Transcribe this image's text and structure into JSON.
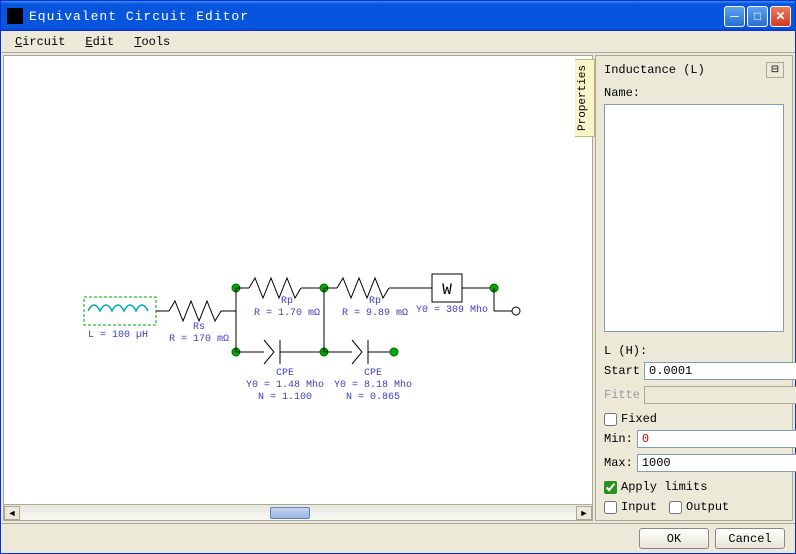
{
  "window": {
    "title": "Equivalent Circuit Editor"
  },
  "menu": {
    "circuit": "Circuit",
    "edit": "Edit",
    "tools": "Tools"
  },
  "panel": {
    "tab": "Properties",
    "title": "Inductance (L)",
    "name_label": "Name:",
    "name_value": "",
    "lh_label": "L (H):",
    "start_label": "Start",
    "start_value": "0.0001",
    "fitte_label": "Fitte",
    "fitte_value": "",
    "fixed_label": "Fixed",
    "min_label": "Min:",
    "min_value": "0",
    "max_label": "Max:",
    "max_value": "1000",
    "apply_label": "Apply limits",
    "input_label": "Input",
    "output_label": "Output"
  },
  "buttons": {
    "ok": "OK",
    "cancel": "Cancel"
  },
  "schematic": {
    "L": {
      "name": "L",
      "value": "L = 100 µH"
    },
    "Rs": {
      "name": "Rs",
      "value": "R = 170 mΩ"
    },
    "Rp1": {
      "name": "Rp",
      "value": "R = 1.70 mΩ"
    },
    "CPE1": {
      "name": "CPE",
      "y0": "Y0 = 1.48 Mho",
      "n": "N = 1.100"
    },
    "Rp2": {
      "name": "Rp",
      "value": "R = 9.89 mΩ"
    },
    "CPE2": {
      "name": "CPE",
      "y0": "Y0 = 8.18 Mho",
      "n": "N = 0.865"
    },
    "W": {
      "name": "W",
      "value": "Y0 = 309 Mho"
    }
  }
}
